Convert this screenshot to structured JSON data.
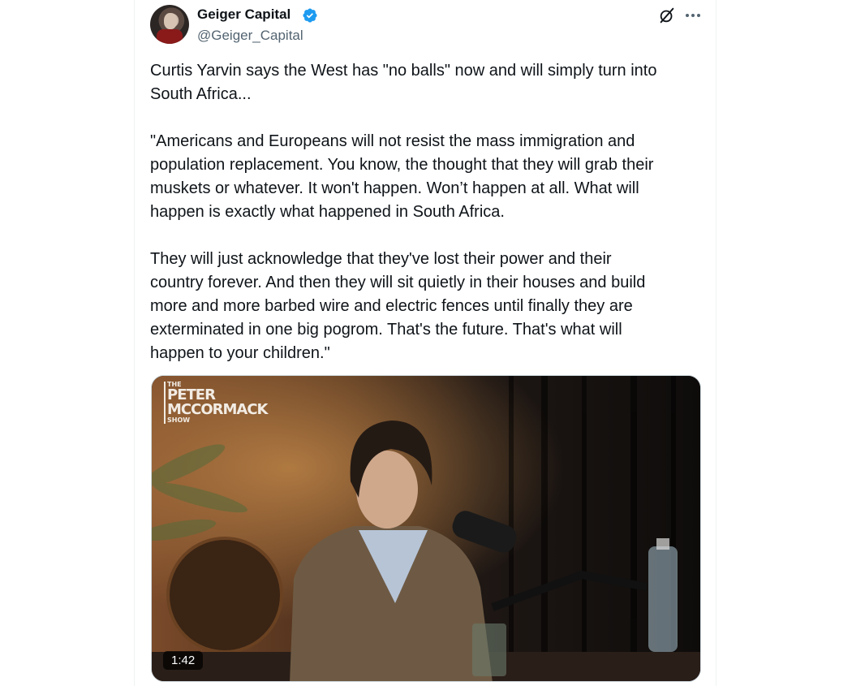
{
  "author": {
    "display_name": "Geiger Capital",
    "handle": "@Geiger_Capital",
    "verified": true
  },
  "header_icons": [
    "grok-icon",
    "more-icon"
  ],
  "tweet": {
    "paragraphs": [
      "Curtis Yarvin says the West has \"no balls\" now and will simply turn into\nSouth Africa...",
      "\"Americans and Europeans will not resist the mass immigration and\npopulation replacement. You know, the thought that they will grab their\nmuskets or whatever. It won't happen. Won’t happen at all. What will\nhappen is exactly what happened in South Africa.",
      "They will just acknowledge that they've lost their power and their\ncountry forever. And then they will sit quietly in their houses and build\nmore and more barbed wire and electric fences until finally they are\nexterminated in one big pogrom. That's the future. That's what will\nhappen to your children.\""
    ]
  },
  "media": {
    "type": "video",
    "duration": "1:42",
    "overlay_logo": {
      "line1": "THE",
      "line2": "PETER",
      "line3": "MCCORMACK",
      "line4": "SHOW"
    }
  },
  "colors": {
    "text": "#0f1419",
    "secondary": "#536471",
    "verified": "#1d9bf0",
    "border": "#eff3f4"
  }
}
